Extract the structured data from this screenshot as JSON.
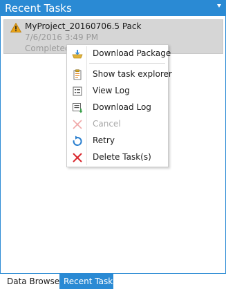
{
  "panel": {
    "title": "Recent Tasks"
  },
  "task": {
    "name": "MyProject_20160706.5 Pack",
    "date": "7/6/2016 3:49 PM",
    "status": "Completed"
  },
  "menu": {
    "items": [
      {
        "label": "Download Package",
        "icon": "download-package-icon",
        "enabled": true
      },
      {
        "label": "Show task explorer",
        "icon": "task-explorer-icon",
        "enabled": true
      },
      {
        "label": "View Log",
        "icon": "view-log-icon",
        "enabled": true
      },
      {
        "label": "Download Log",
        "icon": "download-log-icon",
        "enabled": true
      },
      {
        "label": "Cancel",
        "icon": "cancel-icon",
        "enabled": false
      },
      {
        "label": "Retry",
        "icon": "retry-icon",
        "enabled": true
      },
      {
        "label": "Delete Task(s)",
        "icon": "delete-icon",
        "enabled": true
      }
    ]
  },
  "tabs": [
    {
      "label": "Data Browser",
      "active": false
    },
    {
      "label": "Recent Tasks",
      "active": true
    }
  ],
  "colors": {
    "accent": "#2a8ad4",
    "warning": "#e8a317",
    "delete": "#d9262c"
  }
}
